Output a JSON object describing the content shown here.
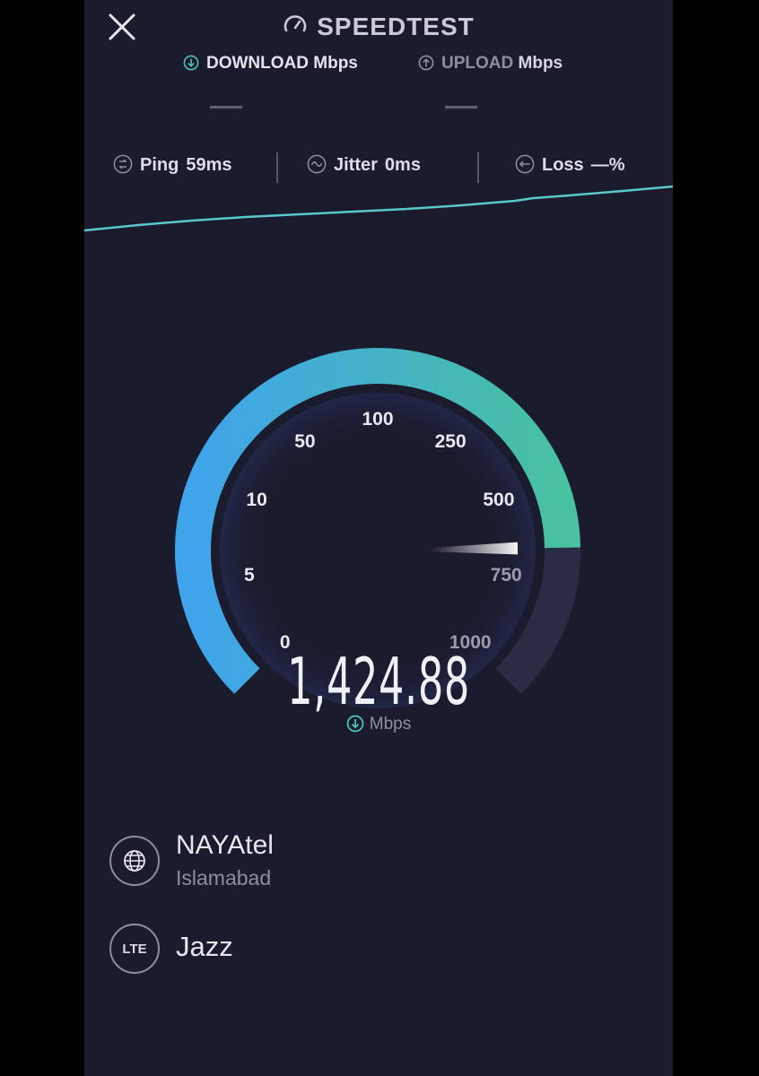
{
  "header": {
    "title": "SPEEDTEST",
    "close_icon": "close-icon",
    "logo_icon": "speedometer-icon"
  },
  "tabs": [
    {
      "label": "DOWNLOAD",
      "unit": "Mbps",
      "icon": "download-arrow-icon",
      "active": true,
      "value": "—"
    },
    {
      "label": "UPLOAD",
      "unit": "Mbps",
      "icon": "upload-arrow-icon",
      "active": false,
      "value": "—"
    }
  ],
  "metrics": [
    {
      "label": "Ping",
      "value": "59ms",
      "icon": "ping-icon"
    },
    {
      "label": "Jitter",
      "value": "0ms",
      "icon": "jitter-icon"
    },
    {
      "label": "Loss",
      "value": "—%",
      "icon": "loss-icon"
    }
  ],
  "gauge": {
    "scale_labels": [
      "0",
      "5",
      "10",
      "50",
      "100",
      "250",
      "500",
      "750",
      "1000"
    ],
    "needle_fraction": 0.83,
    "reading": "1,424.88",
    "unit": "Mbps",
    "colors": {
      "start": "#3fa4ec",
      "end": "#48c2a0",
      "track": "#2a2c45",
      "graph": "#59c8c8"
    }
  },
  "server": {
    "name": "NAYAtel",
    "location": "Islamabad",
    "icon": "globe-icon"
  },
  "connection": {
    "badge": "LTE",
    "carrier": "Jazz"
  }
}
